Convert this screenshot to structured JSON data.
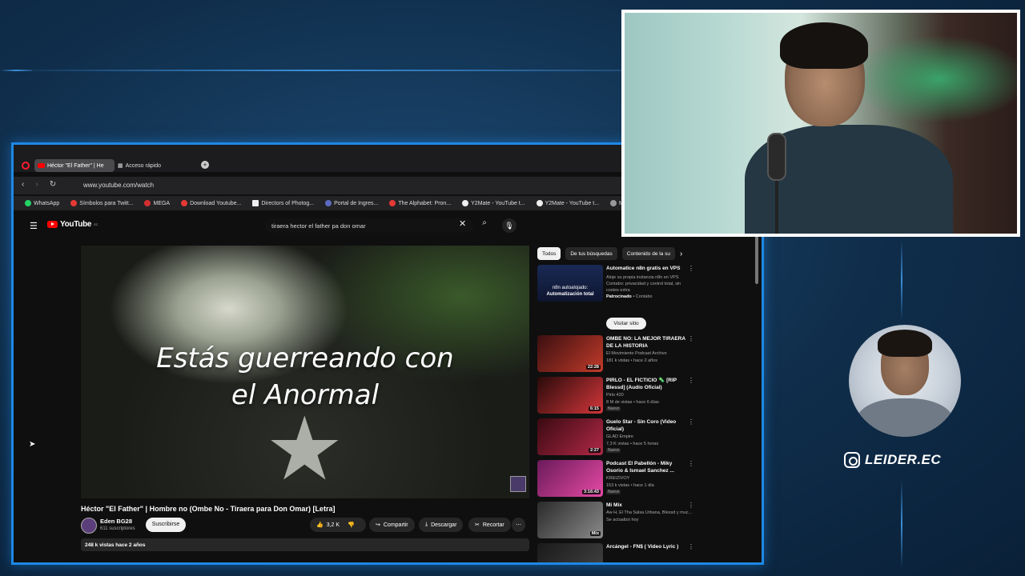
{
  "browser": {
    "tabs": [
      {
        "label": "Héctor \"El Father\" | He"
      },
      {
        "label": "Acceso rápido"
      }
    ],
    "url": "www.youtube.com/watch",
    "bookmarks": [
      {
        "label": "WhatsApp",
        "color": "#25d366"
      },
      {
        "label": "Símbolos para Twitt...",
        "color": "#e53935"
      },
      {
        "label": "MEGA",
        "color": "#d32f2f"
      },
      {
        "label": "Download Youtube...",
        "color": "#e53935"
      },
      {
        "label": "Directors of Photog...",
        "color": "#eeeeee"
      },
      {
        "label": "Portal de Ingres...",
        "color": "#5c6bc0"
      },
      {
        "label": "The Alphabet: Pron...",
        "color": "#e53935"
      },
      {
        "label": "Y2Mate - YouTube t...",
        "color": "#eeeeee"
      },
      {
        "label": "Y2Mate - YouTube t...",
        "color": "#eeeeee"
      },
      {
        "label": "Me",
        "color": "#999999"
      }
    ]
  },
  "youtube": {
    "logo": "YouTube",
    "logo_country": "EC",
    "search_value": "tiraera hector el father pa don omar",
    "lyric_line1": "Estás guerreando con",
    "lyric_line2": "el Anormal",
    "video_title": "Héctor \"El Father\" | Hombre no (Ombe No - Tiraera para Don Omar) [Letra]",
    "channel_name": "Eden BG28",
    "channel_subs": "611 suscriptores",
    "subscribe": "Suscribirse",
    "likes": "3,2 K",
    "share": "Compartir",
    "download": "Descargar",
    "clip": "Recortar",
    "description_meta": "248 k vistas  hace 2 años",
    "chips": [
      "Todos",
      "De tus búsquedas",
      "Contenido de la su"
    ],
    "ad": {
      "title": "Automatice n8n gratis en VPS",
      "desc": "Aloje su propia instancia n8n en VPS Contabo: privacidad y control total, sin costes extra",
      "sponsor_label": "Patrocinado",
      "sponsor": "Contabo",
      "visit": "Visitar sitio",
      "thumb_text": "n8n autoalojado:",
      "thumb_text2": "Automatización total"
    },
    "recs": [
      {
        "title": "OMBE NO: LA MEJOR TIRAERA DE LA HISTORIA",
        "channel": "El Movimiento Podcast Archivo",
        "meta": "181 k vistas • hace 2 años",
        "duration": "22:28",
        "badge": "",
        "color1": "#3a0f10",
        "color2": "#c23a2a"
      },
      {
        "title": "PIRLO - EL FICTICIO 🦠 [RIP Blessd] (Audio Oficial)",
        "channel": "Pirlo 420",
        "meta": "8 M de vistas • hace 6 días",
        "duration": "6:15",
        "badge": "Nuevo",
        "color1": "#2a0a0a",
        "color2": "#d2363a"
      },
      {
        "title": "Guelo Star - Sin Coro (Video Oficial)",
        "channel": "GLAD Empire",
        "meta": "7,3 K vistas • hace 5 horas",
        "duration": "2:27",
        "badge": "Nuevo",
        "color1": "#3a0a12",
        "color2": "#b02846"
      },
      {
        "title": "Podcast El Pabellón - Miky Osorio & Ismael Sanchez ...",
        "channel": "KREIZIVOY",
        "meta": "153 k vistas • hace 1 día",
        "duration": "3:16:43",
        "badge": "Nuevo",
        "color1": "#6a1a5a",
        "color2": "#e64aa4"
      },
      {
        "title": "Mi Mix",
        "channel": "Aw H, El Tha Salsa Urbana, Blessd y muc...",
        "meta": "Se actualizó hoy",
        "duration": "Mix",
        "badge": "",
        "color1": "#2a2a2a",
        "color2": "#8a8a8a"
      },
      {
        "title": "Arcángel - FN$ ( Video Lyric )",
        "channel": "",
        "meta": "",
        "duration": "",
        "badge": "",
        "color1": "#1a1a1a",
        "color2": "#444444"
      }
    ]
  },
  "overlay": {
    "instagram_handle": "LEIDER.EC"
  }
}
